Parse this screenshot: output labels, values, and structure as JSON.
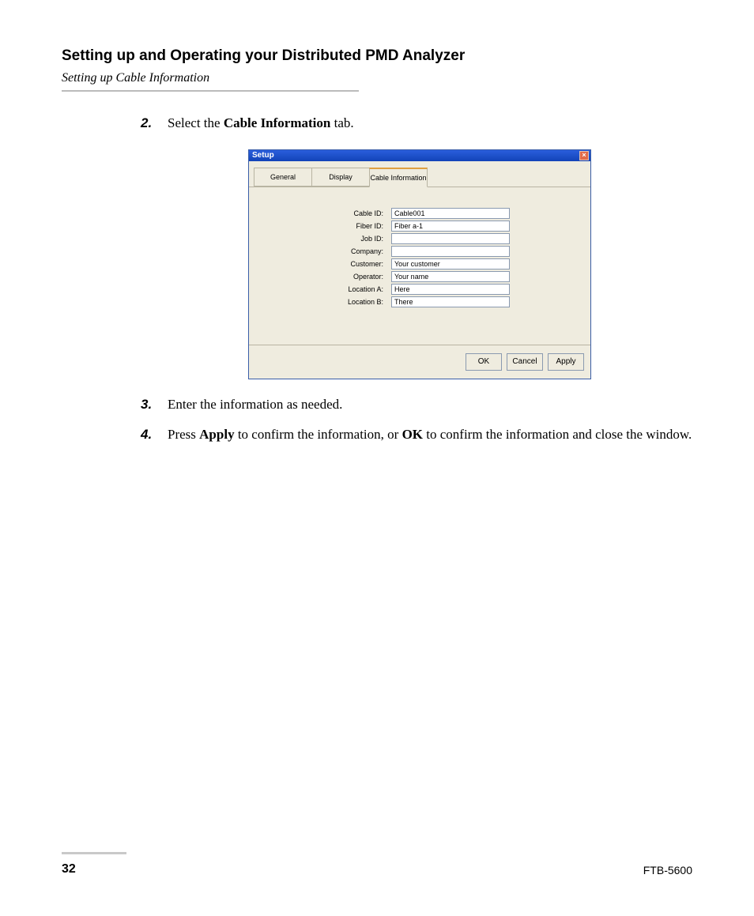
{
  "header": {
    "chapter": "Setting up and Operating your Distributed PMD Analyzer",
    "section": "Setting up Cable Information"
  },
  "steps": {
    "s2": {
      "num": "2.",
      "pre": "Select the ",
      "bold": "Cable Information",
      "post": " tab."
    },
    "s3": {
      "num": "3.",
      "text": "Enter the information as needed."
    },
    "s4": {
      "num": "4.",
      "pre": "Press ",
      "bold1": "Apply",
      "mid": " to confirm the information, or ",
      "bold2": "OK",
      "post": " to confirm the information and close the window."
    }
  },
  "setup_window": {
    "title": "Setup",
    "close_glyph": "×",
    "tabs": {
      "general": "General",
      "display": "Display",
      "cable_info": "Cable Information"
    },
    "fields": {
      "cable_id": {
        "label": "Cable ID:",
        "value": "Cable001"
      },
      "fiber_id": {
        "label": "Fiber ID:",
        "value": "Fiber a-1"
      },
      "job_id": {
        "label": "Job ID:",
        "value": ""
      },
      "company": {
        "label": "Company:",
        "value": ""
      },
      "customer": {
        "label": "Customer:",
        "value": "Your customer"
      },
      "operator": {
        "label": "Operator:",
        "value": "Your name"
      },
      "location_a": {
        "label": "Location A:",
        "value": "Here"
      },
      "location_b": {
        "label": "Location B:",
        "value": "There"
      }
    },
    "buttons": {
      "ok": "OK",
      "cancel": "Cancel",
      "apply": "Apply"
    }
  },
  "footer": {
    "page": "32",
    "model": "FTB-5600"
  }
}
